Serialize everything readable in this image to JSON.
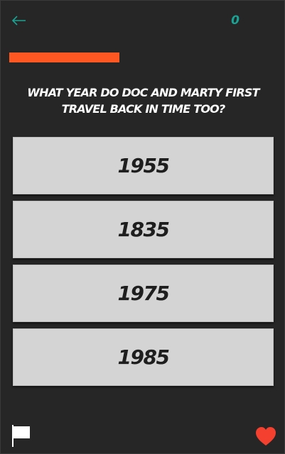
{
  "header": {
    "back_icon": "arrow-left-icon",
    "score": "0"
  },
  "progress": {
    "fraction": 0.41,
    "color": "#fe5722"
  },
  "question": {
    "text": "WHAT YEAR DO DOC AND MARTY FIRST TRAVEL BACK IN TIME TOO?"
  },
  "answers": [
    {
      "label": "1955"
    },
    {
      "label": "1835"
    },
    {
      "label": "1975"
    },
    {
      "label": "1985"
    }
  ],
  "footer": {
    "flag_icon": "flag-icon",
    "heart_icon": "heart-icon",
    "heart_color": "#f4402e"
  },
  "colors": {
    "background": "#262626",
    "accent_teal": "#1aa394",
    "answer_bg": "#d4d4d4"
  }
}
